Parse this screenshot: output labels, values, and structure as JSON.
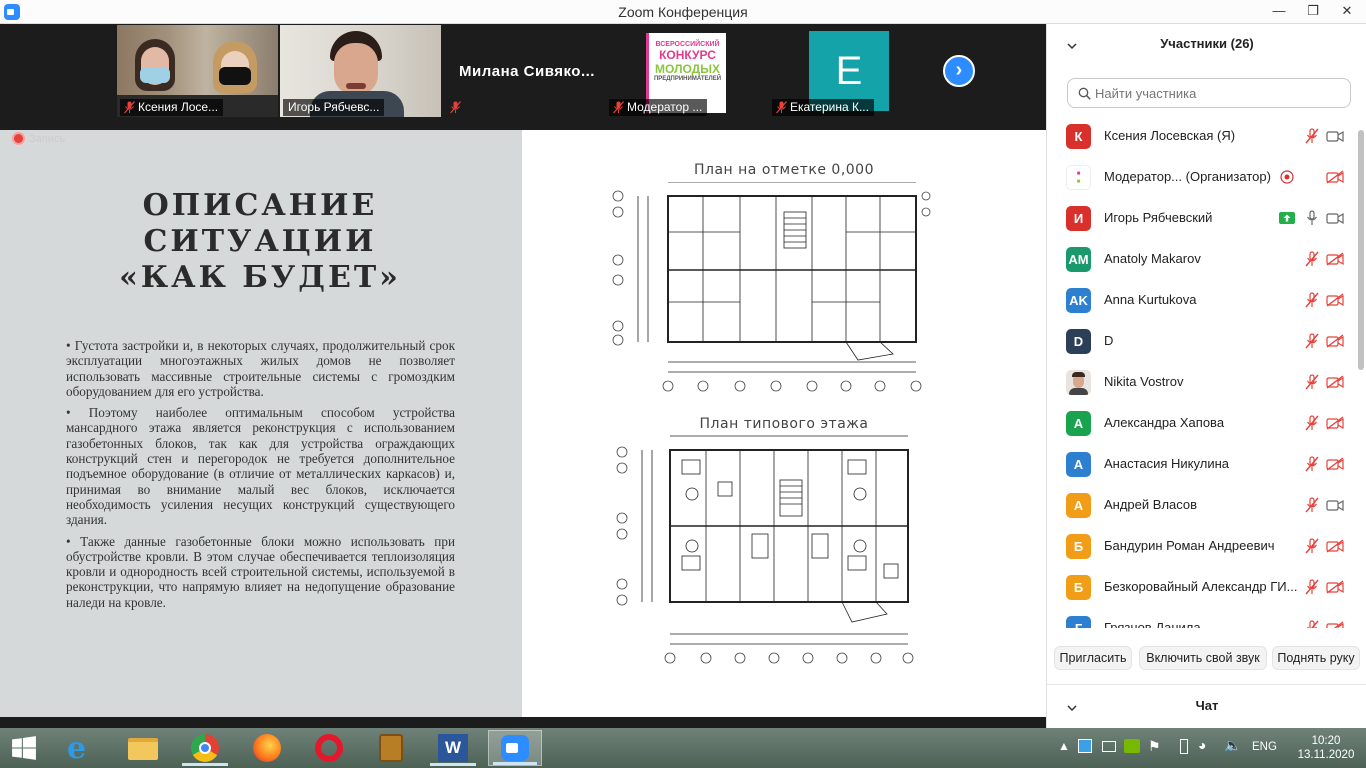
{
  "window": {
    "title": "Zoom Конференция"
  },
  "video_strip": {
    "tiles": [
      {
        "name": "Ксения Лосе..."
      },
      {
        "name": "Игорь Рябчевс..."
      },
      {
        "name": "Милана  Сивяко...",
        "label": ""
      },
      {
        "name": "Модератор ..."
      },
      {
        "name": "Екатерина К...",
        "initial": "E"
      }
    ],
    "contest_logo": {
      "line1": "ВСЕРОССИЙСКИЙ",
      "line2": "КОНКУРС",
      "line3": "МОЛОДЫХ",
      "line4": "ПРЕДПРИНИМАТЕЛЕЙ"
    },
    "bigname": "Милана  Сивяко..."
  },
  "share": {
    "recording": "Запись",
    "slide": {
      "title_lines": [
        "ОПИСАНИЕ",
        "СИТУАЦИИ",
        "«КАК БУДЕТ»"
      ],
      "paragraphs": [
        "•   Густота застройки и, в некоторых случаях, продолжительный срок эксплуатации многоэтажных жилых домов не позволяет использовать массивные строительные системы с громоздким оборудованием для его устройства.",
        "•   Поэтому наиболее оптимальным способом устройства мансардного этажа является реконструкция с использованием газобетонных блоков, так как для устройства ограждающих конструкций стен и перегородок не требуется дополнительное подъемное оборудование (в отличие от металлических каркасов) и, принимая во внимание малый вес блоков, исключается необходимость усиления несущих конструкций существующего здания.",
        "•   Также данные газобетонные блоки можно использовать при обустройстве кровли. В этом случае обеспечивается теплоизоляция кровли и однородность всей строительной системы, используемой в реконструкции, что напрямую влияет на недопущение образование наледи на кровле."
      ],
      "plan1_title": "План на отметке 0,000",
      "plan2_title": "План типового этажа"
    }
  },
  "panel": {
    "participants_header": "Участники (26)",
    "search_placeholder": "Найти участника",
    "participants": [
      {
        "initials": "К",
        "name": "Ксения Лосевская (Я)",
        "color": "#d9302c",
        "mic": "muted",
        "video": "on"
      },
      {
        "initials": "",
        "name": "Модератор...  (Организатор)",
        "color": "#ffffff",
        "mic": "recording",
        "video": "off",
        "logo": true
      },
      {
        "initials": "И",
        "name": "Игорь Рябчевский",
        "color": "#d9302c",
        "mic": "on",
        "video": "on",
        "share": true
      },
      {
        "initials": "AM",
        "name": "Anatoly Makarov",
        "color": "#1a9a6c",
        "mic": "muted",
        "video": "off"
      },
      {
        "initials": "AK",
        "name": "Anna Kurtukova",
        "color": "#2d7fcf",
        "mic": "muted",
        "video": "off"
      },
      {
        "initials": "D",
        "name": "D",
        "color": "#2c3e58",
        "mic": "muted",
        "video": "off"
      },
      {
        "initials": "",
        "name": "Nikita Vostrov",
        "color": "#e9e4df",
        "mic": "muted",
        "video": "off",
        "photo": true
      },
      {
        "initials": "А",
        "name": "Александра Хапова",
        "color": "#19a34f",
        "mic": "muted",
        "video": "off"
      },
      {
        "initials": "А",
        "name": "Анастасия Никулина",
        "color": "#2d7fcf",
        "mic": "muted",
        "video": "off"
      },
      {
        "initials": "А",
        "name": "Андрей Власов",
        "color": "#f29d17",
        "mic": "muted",
        "video": "on"
      },
      {
        "initials": "Б",
        "name": "Бандурин Роман Андреевич",
        "color": "#f29d17",
        "mic": "muted",
        "video": "off"
      },
      {
        "initials": "Б",
        "name": "Безкоровайный Александр ГИ...",
        "color": "#f29d17",
        "mic": "muted",
        "video": "off"
      },
      {
        "initials": "Г",
        "name": "Грязнов Данила",
        "color": "#2d7fcf",
        "mic": "muted",
        "video": "off"
      }
    ],
    "buttons": {
      "invite": "Пригласить",
      "unmute": "Включить свой звук",
      "raise_hand": "Поднять руку"
    },
    "chat_header": "Чат"
  },
  "taskbar": {
    "lang": "ENG",
    "time": "10:20",
    "date": "13.11.2020"
  }
}
